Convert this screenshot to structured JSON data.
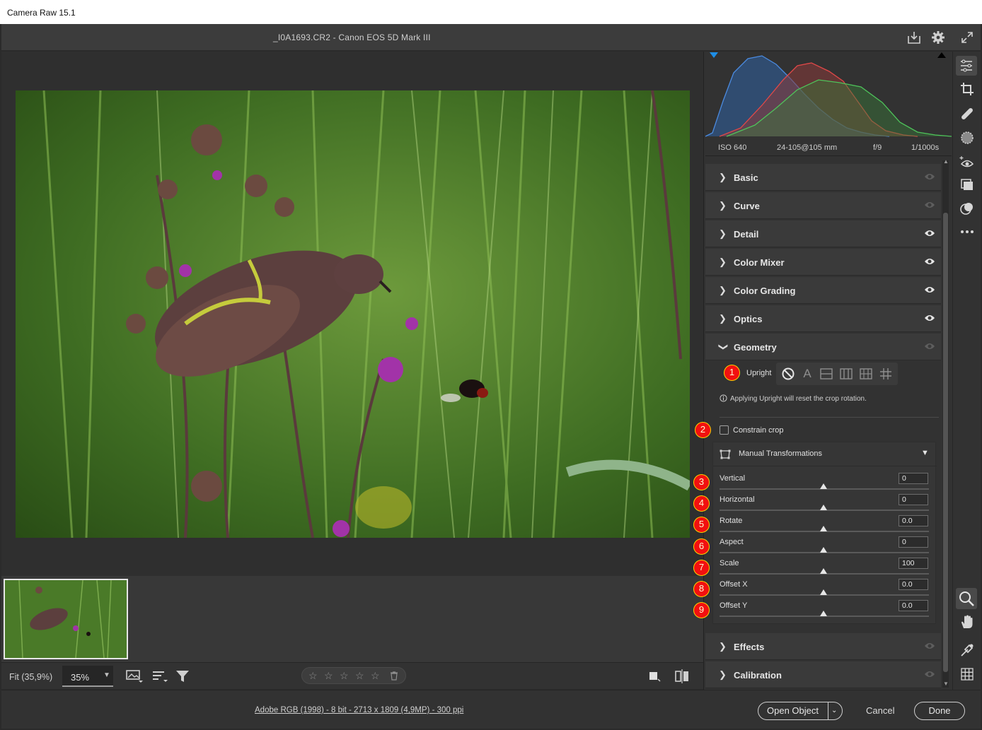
{
  "window": {
    "title": "Camera Raw 15.1"
  },
  "document": {
    "title": "_I0A1693.CR2  -  Canon EOS 5D Mark III"
  },
  "histogram_info": {
    "iso": "ISO 640",
    "lens": "24-105@105 mm",
    "aperture": "f/9",
    "shutter": "1/1000s"
  },
  "panels": [
    {
      "label": "Basic",
      "expanded": false,
      "visible": false
    },
    {
      "label": "Curve",
      "expanded": false,
      "visible": false
    },
    {
      "label": "Detail",
      "expanded": false,
      "visible": true
    },
    {
      "label": "Color Mixer",
      "expanded": false,
      "visible": true
    },
    {
      "label": "Color Grading",
      "expanded": false,
      "visible": true
    },
    {
      "label": "Optics",
      "expanded": false,
      "visible": true
    },
    {
      "label": "Geometry",
      "expanded": true,
      "visible": false
    },
    {
      "label": "Effects",
      "expanded": false,
      "visible": false
    },
    {
      "label": "Calibration",
      "expanded": false,
      "visible": false
    }
  ],
  "geometry": {
    "upright_label": "Upright",
    "upright_note": "Applying Upright will reset the crop rotation.",
    "constrain_crop_label": "Constrain crop",
    "constrain_crop_checked": false,
    "manual_transformations_label": "Manual Transformations",
    "sliders": [
      {
        "label": "Vertical",
        "value": "0"
      },
      {
        "label": "Horizontal",
        "value": "0"
      },
      {
        "label": "Rotate",
        "value": "0.0"
      },
      {
        "label": "Aspect",
        "value": "0"
      },
      {
        "label": "Scale",
        "value": "100"
      },
      {
        "label": "Offset X",
        "value": "0.0"
      },
      {
        "label": "Offset Y",
        "value": "0.0"
      }
    ]
  },
  "callouts": [
    "1",
    "2",
    "3",
    "4",
    "5",
    "6",
    "7",
    "8",
    "9"
  ],
  "statusbar": {
    "fit_label": "Fit (35,9%)",
    "zoom_value": "35%"
  },
  "footer": {
    "workflow_link": "Adobe RGB (1998) - 8 bit - 2713 x 1809 (4,9MP) - 300 ppi",
    "open_object": "Open Object",
    "cancel": "Cancel",
    "done": "Done"
  },
  "colors": {
    "callout_fill": "#f21010",
    "callout_border": "#ffd200",
    "panel_bg": "#3a3a3a",
    "app_bg": "#2b2b2b"
  },
  "icons": [
    "export-icon",
    "gear-icon",
    "fullscreen-icon",
    "edit-sliders-icon",
    "crop-icon",
    "healing-icon",
    "masking-icon",
    "red-eye-icon",
    "snapshots-icon",
    "presets-icon",
    "more-icon",
    "zoom-icon",
    "hand-icon",
    "color-sampler-icon",
    "grid-icon"
  ]
}
